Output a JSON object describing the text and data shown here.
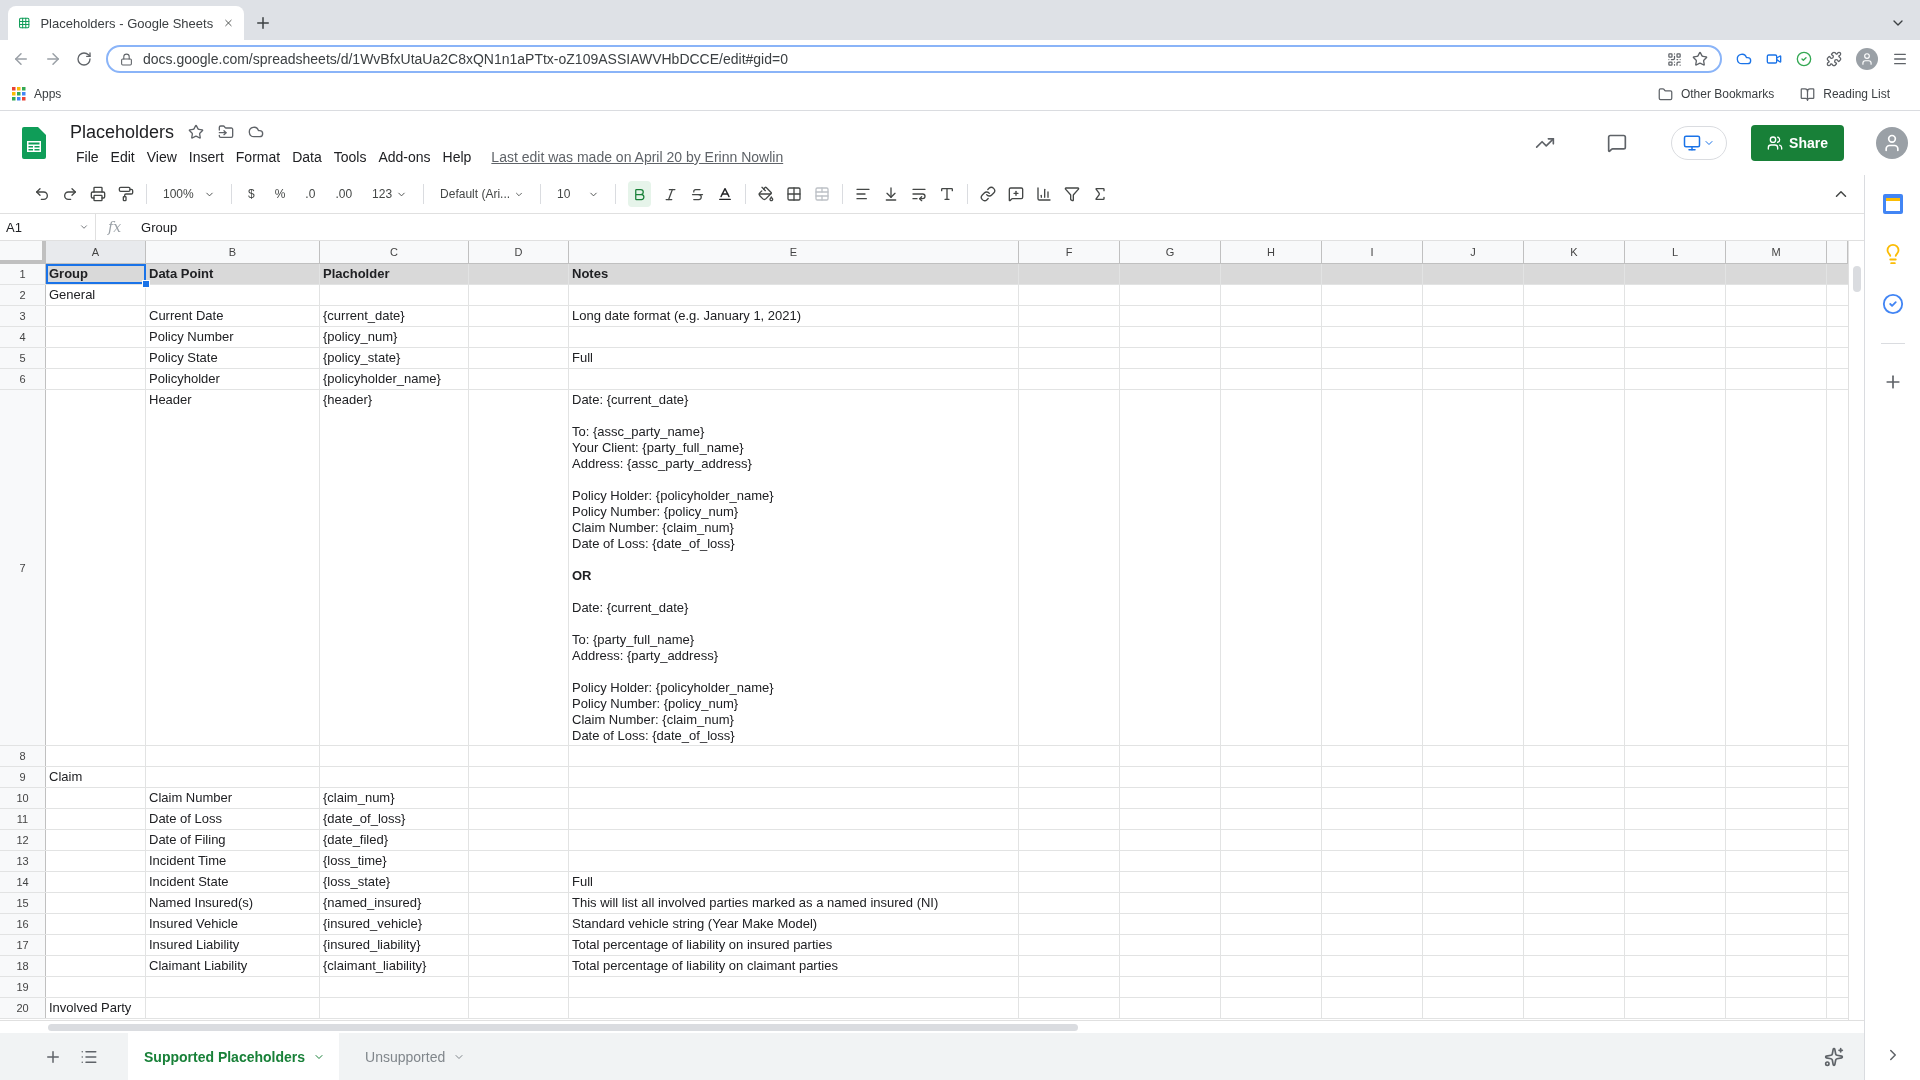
{
  "browser": {
    "tab_title": "Placeholders - Google Sheets",
    "url": "docs.google.com/spreadsheets/d/1WvBfxUtaUa2C8xQN1n1aPTtx-oZ109ASSIAWVHbDCCE/edit#gid=0",
    "bookmarks": [
      "Apps"
    ],
    "right_bookmarks": [
      "Other Bookmarks",
      "Reading List"
    ]
  },
  "doc": {
    "title": "Placeholders",
    "menus": [
      "File",
      "Edit",
      "View",
      "Insert",
      "Format",
      "Data",
      "Tools",
      "Add-ons",
      "Help"
    ],
    "last_edit": "Last edit was made on April 20 by Erinn Nowlin",
    "share": "Share"
  },
  "toolbar": {
    "zoom": "100%",
    "currency": "$",
    "percent": "%",
    "decimal_less": ".0",
    "decimal_more": ".00",
    "number_format": "123",
    "font": "Default (Ari...",
    "font_size": "10",
    "bold_on": true
  },
  "formula_bar": {
    "cell_ref": "A1",
    "fx": "fx",
    "value": "Group"
  },
  "columns": [
    "A",
    "B",
    "C",
    "D",
    "E",
    "F",
    "G",
    "H",
    "I",
    "J",
    "K",
    "L",
    "M"
  ],
  "rows": [
    {
      "number": "1",
      "header": true,
      "cells": {
        "A": {
          "text": "Group",
          "selected": true
        },
        "B": "Data Point",
        "C": "Placholder",
        "E": "Notes"
      }
    },
    {
      "number": "2",
      "cells": {
        "A": "General"
      }
    },
    {
      "number": "3",
      "cells": {
        "B": "Current Date",
        "C": "{current_date}",
        "E": "Long date format (e.g. January 1, 2021)"
      }
    },
    {
      "number": "4",
      "cells": {
        "B": "Policy Number",
        "C": "{policy_num}"
      }
    },
    {
      "number": "5",
      "cells": {
        "B": "Policy State",
        "C": "{policy_state}",
        "E": "Full"
      }
    },
    {
      "number": "6",
      "cells": {
        "B": "Policyholder",
        "C": "{policyholder_name}"
      }
    },
    {
      "number": "7",
      "cells": {
        "B": "Header",
        "C": "{header}",
        "E": "Date: {current_date}\n\nTo: {assc_party_name}\nYour Client: {party_full_name}\nAddress: {assc_party_address}\n\nPolicy Holder: {policyholder_name}\nPolicy Number: {policy_num}\nClaim Number: {claim_num}\nDate of Loss: {date_of_loss}\n\n**OR**\n\nDate: {current_date}\n\nTo: {party_full_name}\nAddress: {party_address}\n\nPolicy Holder: {policyholder_name}\nPolicy Number: {policy_num}\nClaim Number: {claim_num}\nDate of Loss: {date_of_loss}"
      }
    },
    {
      "number": "8",
      "cells": {}
    },
    {
      "number": "9",
      "cells": {
        "A": "Claim"
      }
    },
    {
      "number": "10",
      "cells": {
        "B": "Claim Number",
        "C": "{claim_num}"
      }
    },
    {
      "number": "11",
      "cells": {
        "B": "Date of Loss",
        "C": "{date_of_loss}"
      }
    },
    {
      "number": "12",
      "cells": {
        "B": "Date of Filing",
        "C": "{date_filed}"
      }
    },
    {
      "number": "13",
      "cells": {
        "B": "Incident Time",
        "C": "{loss_time}"
      }
    },
    {
      "number": "14",
      "cells": {
        "B": "Incident State",
        "C": "{loss_state}",
        "E": "Full"
      }
    },
    {
      "number": "15",
      "cells": {
        "B": "Named Insured(s)",
        "C": "{named_insured}",
        "E": "This will list all involved parties marked as a named insured (NI)"
      }
    },
    {
      "number": "16",
      "cells": {
        "B": "Insured Vehicle",
        "C": "{insured_vehicle}",
        "E": "Standard vehicle string (Year Make Model)"
      }
    },
    {
      "number": "17",
      "cells": {
        "B": "Insured Liability",
        "C": "{insured_liability}",
        "E": "Total percentage of liability on insured parties"
      }
    },
    {
      "number": "18",
      "cells": {
        "B": "Claimant Liability",
        "C": "{claimant_liability}",
        "E": "Total percentage of liability on claimant parties"
      }
    },
    {
      "number": "19",
      "cells": {}
    },
    {
      "number": "20",
      "cells": {
        "A": "Involved Party"
      }
    }
  ],
  "sheet_tabs": [
    {
      "label": "Supported Placeholders",
      "selected": true
    },
    {
      "label": "Unsupported",
      "selected": false
    }
  ]
}
